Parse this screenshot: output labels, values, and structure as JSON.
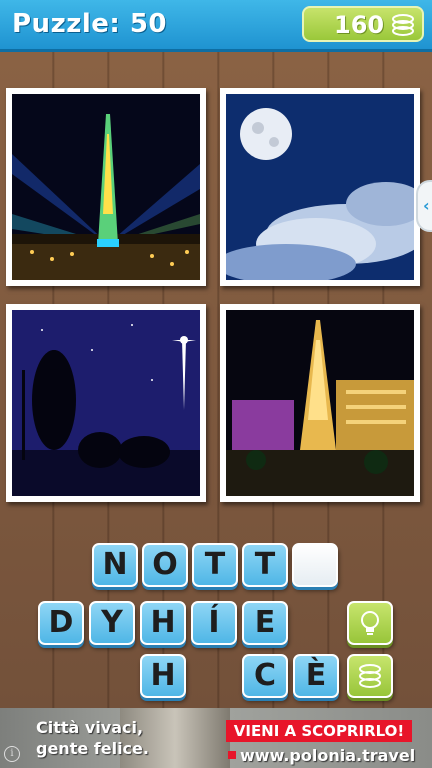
{
  "header": {
    "title": "Puzzle: 50",
    "coins": "160"
  },
  "photos": [
    {
      "name": "tv-tower-lights-night"
    },
    {
      "name": "full-moon-clouds"
    },
    {
      "name": "shepherd-star-night"
    },
    {
      "name": "las-vegas-eiffel-night"
    }
  ],
  "answer_slots": [
    "N",
    "O",
    "T",
    "T",
    ""
  ],
  "letter_pool": {
    "row1": [
      "D",
      "Y",
      "H",
      "Í",
      "E"
    ],
    "row2": [
      "H",
      "",
      "C",
      "È"
    ]
  },
  "ad": {
    "line1": "Città vivaci,",
    "line2": "gente felice.",
    "cta": "VIENI A SCOPRIRLO!",
    "url": "www.polonia.travel",
    "info": "i"
  },
  "colors": {
    "header_blue": "#1f93d1",
    "tile_blue": "#4fb6e6",
    "accent_green": "#98c53a",
    "ad_red": "#e8152a"
  }
}
